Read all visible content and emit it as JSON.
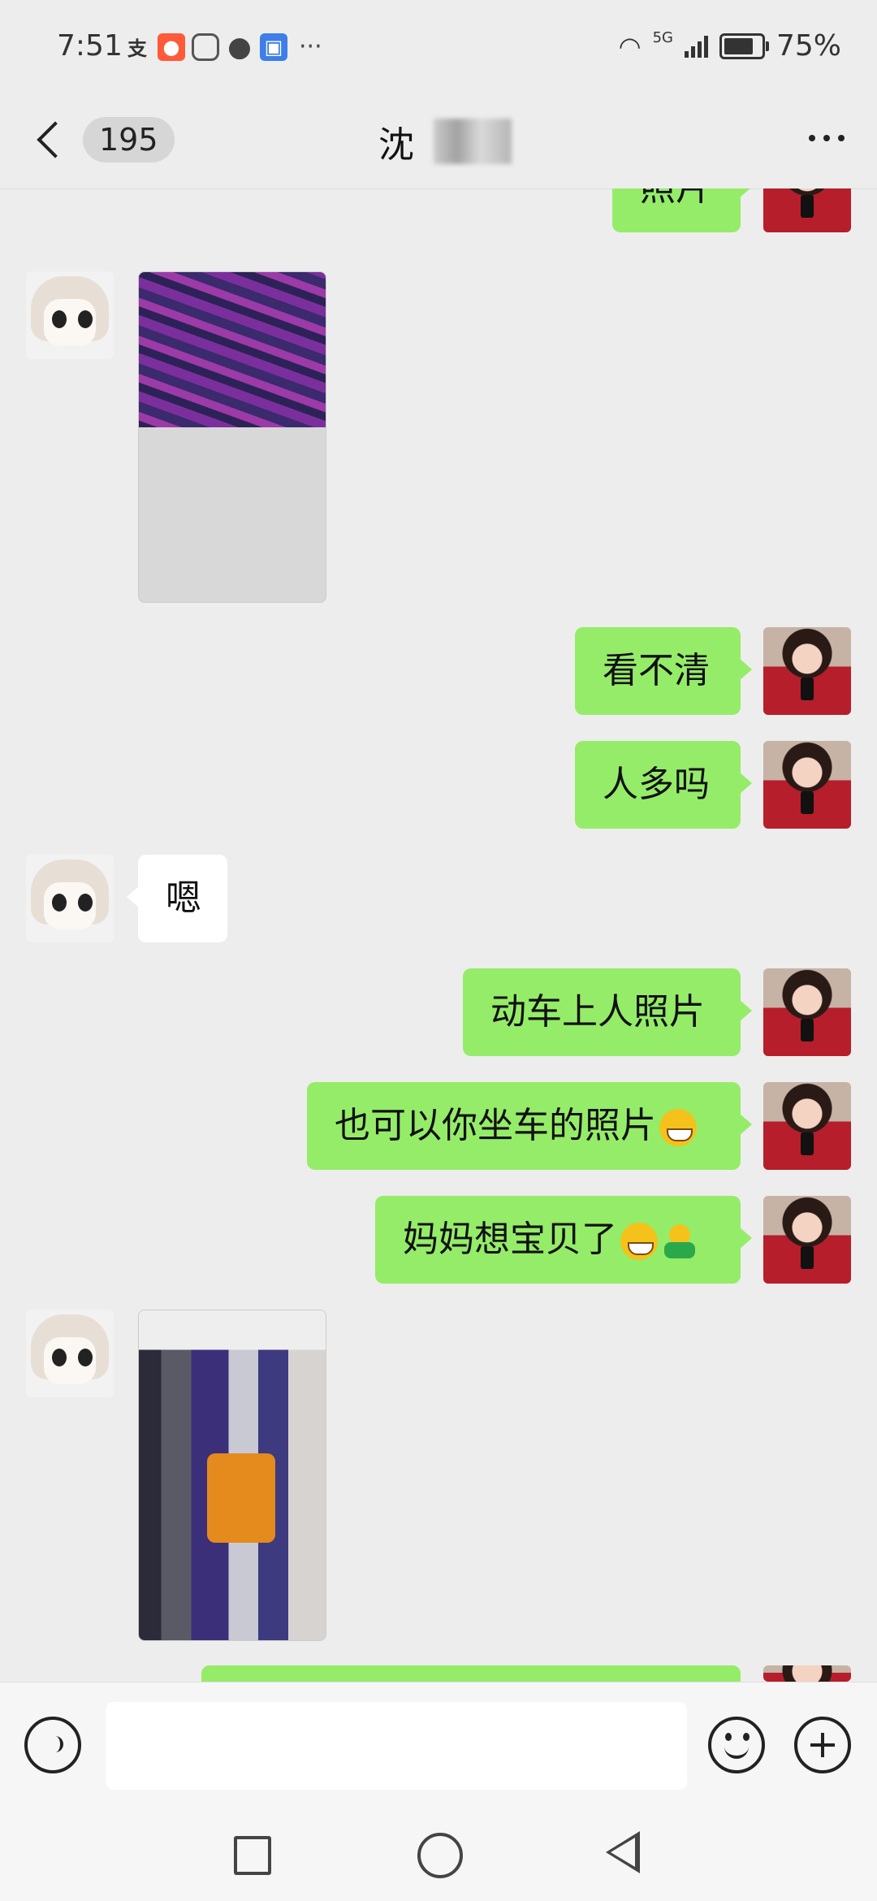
{
  "status_bar": {
    "time": "7:51",
    "network": "5G",
    "battery": "75%",
    "notification_icons": [
      "alipay-icon",
      "kuaishou-icon",
      "shield-icon",
      "message-icon",
      "wallet-icon"
    ],
    "overflow": "···"
  },
  "header": {
    "unread_count": "195",
    "contact_name": "沈"
  },
  "messages": [
    {
      "sender": "me",
      "type": "text",
      "text": "照片"
    },
    {
      "sender": "other",
      "type": "image",
      "image": "photo-seat-fabric"
    },
    {
      "sender": "me",
      "type": "text",
      "text": "看不清"
    },
    {
      "sender": "me",
      "type": "text",
      "text": "人多吗"
    },
    {
      "sender": "other",
      "type": "text",
      "text": "嗯"
    },
    {
      "sender": "me",
      "type": "text",
      "text": "动车上人照片"
    },
    {
      "sender": "me",
      "type": "text",
      "text": "也可以你坐车的照片",
      "emoji": [
        "grin-icon"
      ]
    },
    {
      "sender": "me",
      "type": "text",
      "text": "妈妈想宝贝了",
      "emoji": [
        "grin-icon",
        "hug-icon"
      ]
    },
    {
      "sender": "other",
      "type": "image",
      "image": "photo-train-interior"
    },
    {
      "sender": "me",
      "type": "text",
      "text": ""
    }
  ],
  "input": {
    "placeholder": "",
    "value": ""
  },
  "colors": {
    "chat_background": "#ededed",
    "my_bubble": "#95ec69",
    "their_bubble": "#ffffff"
  }
}
